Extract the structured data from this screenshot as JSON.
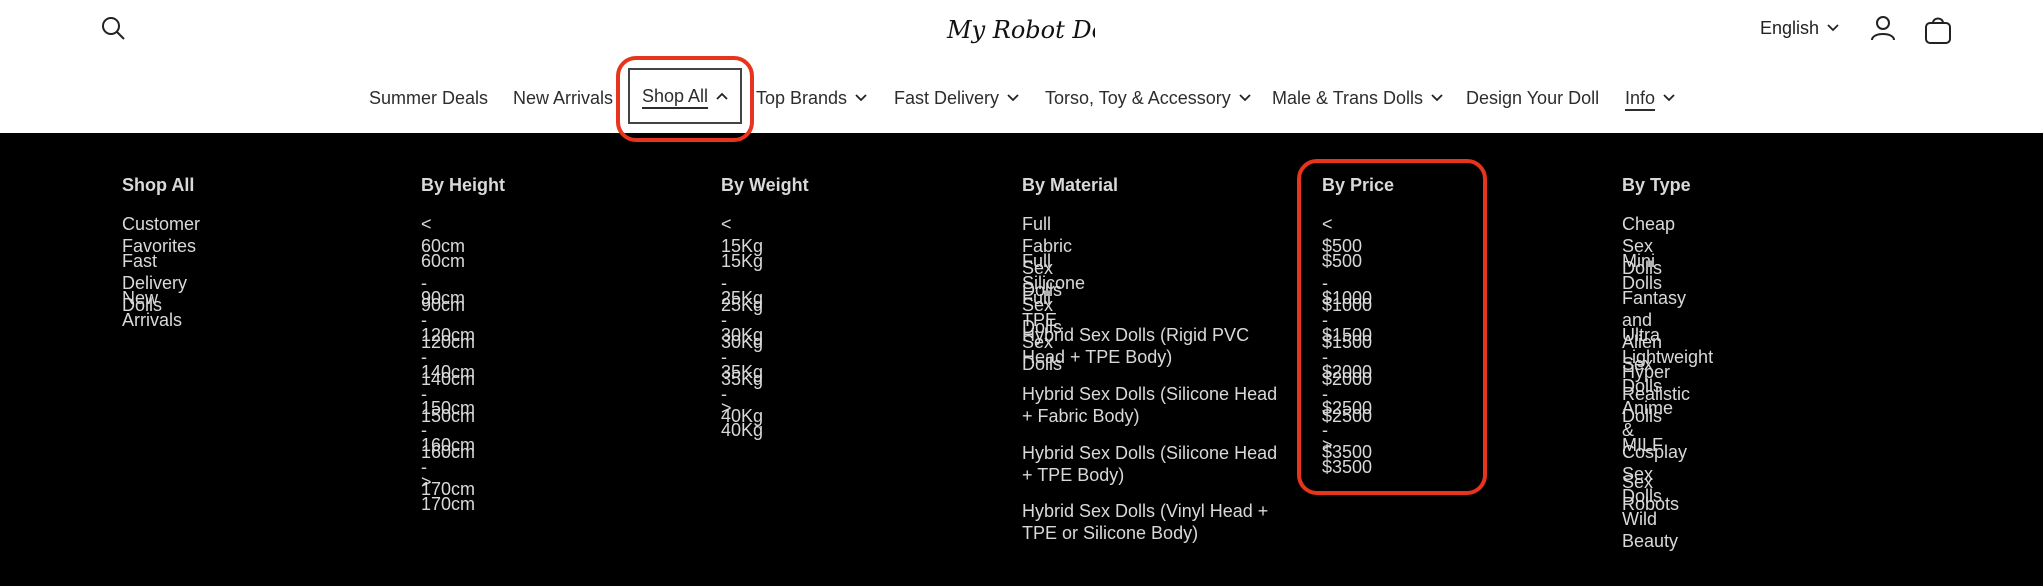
{
  "header": {
    "logo_text": "My Robot Doll",
    "language": "English"
  },
  "nav": {
    "items": [
      {
        "label": "Summer Deals"
      },
      {
        "label": "New Arrivals"
      },
      {
        "label": "Shop All"
      },
      {
        "label": "Top Brands"
      },
      {
        "label": "Fast Delivery"
      },
      {
        "label": "Torso, Toy & Accessory"
      },
      {
        "label": "Male & Trans Dolls"
      },
      {
        "label": "Design Your Doll"
      },
      {
        "label": "Info"
      }
    ]
  },
  "menu": {
    "columns": [
      {
        "title": "Shop All",
        "links": [
          "Customer Favorites",
          "Fast Delivery Dolls",
          "New Arrivals"
        ]
      },
      {
        "title": "By Height",
        "links": [
          "< 60cm",
          "60cm - 90cm",
          "90cm - 120cm",
          "120cm - 140cm",
          "140cm - 150cm",
          "150cm - 160cm",
          "160cm - 170cm",
          "> 170cm"
        ]
      },
      {
        "title": "By Weight",
        "links": [
          "< 15Kg",
          "15Kg - 25Kg",
          "25Kg - 30Kg",
          "30Kg - 35Kg",
          "35Kg - 40Kg",
          "> 40Kg"
        ]
      },
      {
        "title": "By Material",
        "links": [
          "Full Fabric Sex Dolls",
          "Full Silicone Sex Dolls",
          "Full TPE Sex Dolls",
          "Hybrid Sex Dolls (Rigid PVC Head + TPE Body)",
          "Hybrid Sex Dolls (Silicone Head + Fabric Body)",
          "Hybrid Sex Dolls (Silicone Head + TPE Body)",
          "Hybrid Sex Dolls (Vinyl Head + TPE or Silicone Body)"
        ]
      },
      {
        "title": "By Price",
        "links": [
          "< $500",
          "$500 - $1000",
          "$1000 - $1500",
          "$1500 - $2000",
          "$2000 - $2500",
          "$2500 - $3500",
          "> $3500"
        ]
      },
      {
        "title": "By Type",
        "links": [
          "Cheap Sex Dolls",
          "Mini Dolls",
          "Fantasy and Alien Sex Dolls",
          "Ultra Lightweight",
          "Hyper Realistic Dolls",
          "Anime & Cosplay Sex Dolls",
          "MILF",
          "Sex Robots",
          "Wild Beauty"
        ]
      }
    ]
  },
  "colors": {
    "highlight": "#e8341c",
    "menu_bg": "#000000",
    "menu_text": "#d9d9d9"
  }
}
